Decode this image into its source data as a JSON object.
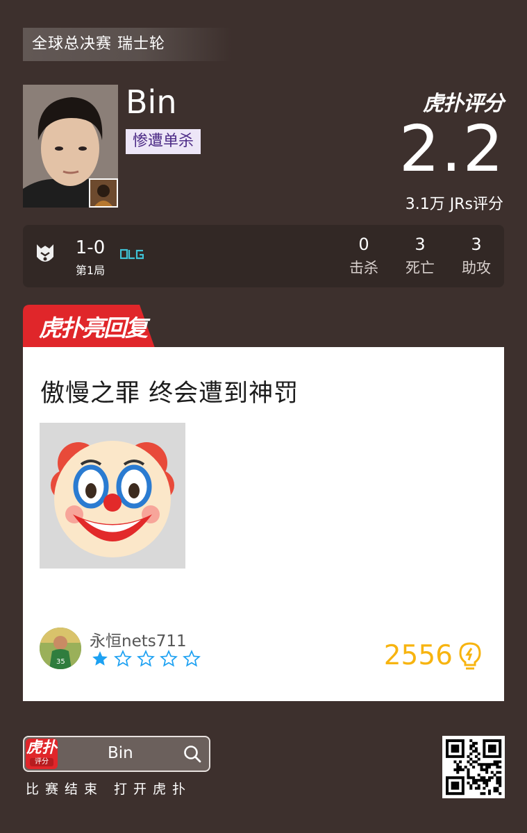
{
  "header": {
    "tag": "全球总决赛 瑞士轮"
  },
  "player": {
    "name": "Bin",
    "badge": "惨遭单杀"
  },
  "rating": {
    "brand": "虎扑评分",
    "score": "2.2",
    "votes": "3.1万 JRs评分"
  },
  "match": {
    "score": "1-0",
    "round": "第1局",
    "stats": [
      {
        "value": "0",
        "label": "击杀"
      },
      {
        "value": "3",
        "label": "死亡"
      },
      {
        "value": "3",
        "label": "助攻"
      }
    ]
  },
  "comment_section": {
    "ribbon": "虎扑亮回复",
    "headline": "傲慢之罪 终会遭到神罚",
    "user": "永恒nets711",
    "stars": 1,
    "stars_max": 5,
    "likes": "2556"
  },
  "footer": {
    "app_icon_big": "虎扑",
    "app_icon_small": "评分",
    "search_text": "Bin",
    "slogan": "比赛结束 打开虎扑"
  },
  "colors": {
    "background": "#3d302d",
    "ribbon": "#e0262a",
    "likes": "#f7b410",
    "star": "#1da1f2"
  },
  "icons": [
    "g2-logo-icon",
    "blg-logo-icon",
    "clown-emoji-icon",
    "star-icon",
    "lightbulb-icon",
    "search-icon",
    "qr-code-icon"
  ]
}
